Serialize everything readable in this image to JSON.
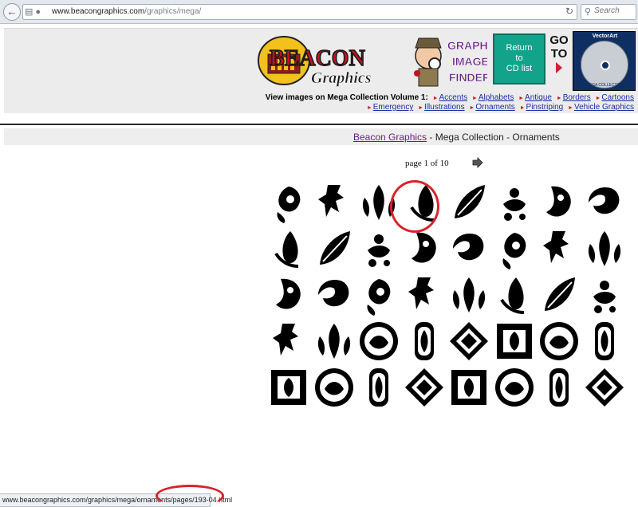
{
  "browser": {
    "url_host": "www.beacongraphics.com",
    "url_path": "/graphics/mega/",
    "search_placeholder": "Search"
  },
  "header": {
    "logo_text_1": "BEACON",
    "logo_text_2": "Graphics",
    "finder_text": [
      "GRAPHIC",
      "IMAGE",
      "FINDER"
    ],
    "return_label": [
      "Return",
      "to",
      "CD list"
    ],
    "goto_label": [
      "GO",
      "TO"
    ],
    "cd_brand": "VectorArt",
    "cd_subtitle": "MEGA COLLECTION"
  },
  "collection_links": {
    "lead": "View images on Mega Collection Volume 1:",
    "items": [
      "Accents",
      "Alphabets",
      "Antique",
      "Borders",
      "Cartoons",
      "Emergency",
      "Illustrations",
      "Ornaments",
      "Pinstriping",
      "Vehicle Graphics"
    ]
  },
  "title_bar": {
    "link": "Beacon Graphics",
    "rest": " - Mega Collection - Ornaments"
  },
  "pager": {
    "text": "page 1 of 10"
  },
  "thumbnails": {
    "count": 40,
    "columns": 8,
    "highlighted_index": 3
  },
  "status_bar": {
    "url": "www.beacongraphics.com/graphics/mega/ornaments/pages/193-04.html"
  },
  "colors": {
    "annotation_red": "#d8232a",
    "link_blue": "#1a2fa0",
    "visited_purple": "#6a1e8c",
    "return_teal": "#12a38b"
  }
}
